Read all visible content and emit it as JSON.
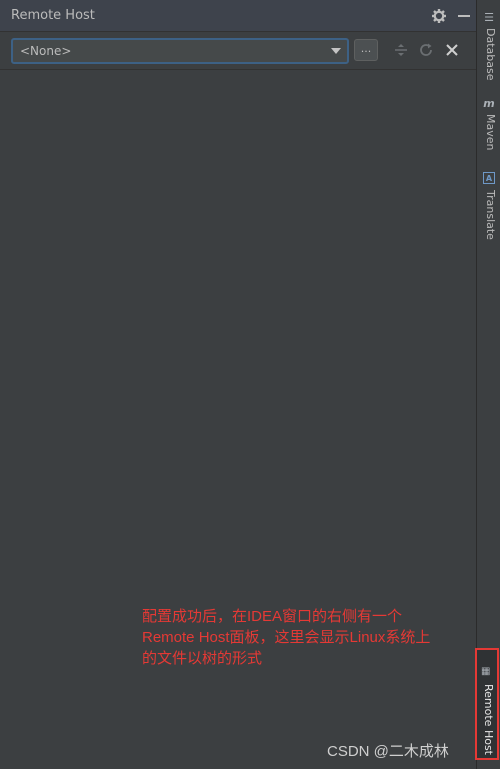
{
  "window": {
    "title": "Remote Host"
  },
  "toolbar": {
    "combo_value": "<None>",
    "browse_label": "..."
  },
  "annotation": {
    "lines": [
      "配置成功后，在IDEA窗口的右侧有一个",
      "Remote Host面板，这里会显示Linux系统上",
      "的文件以树的形式"
    ]
  },
  "side_tabs": [
    {
      "label": "Database",
      "icon": "database-icon"
    },
    {
      "label": "Maven",
      "icon": "maven-icon"
    },
    {
      "label": "Translate",
      "icon": "translate-icon"
    },
    {
      "label": "Remote Host",
      "icon": "remote-host-icon"
    }
  ],
  "watermark": "CSDN @二木成林",
  "colors": {
    "background": "#3c3f41",
    "focus_border": "#3d6185",
    "annotation_red": "#e53935"
  }
}
